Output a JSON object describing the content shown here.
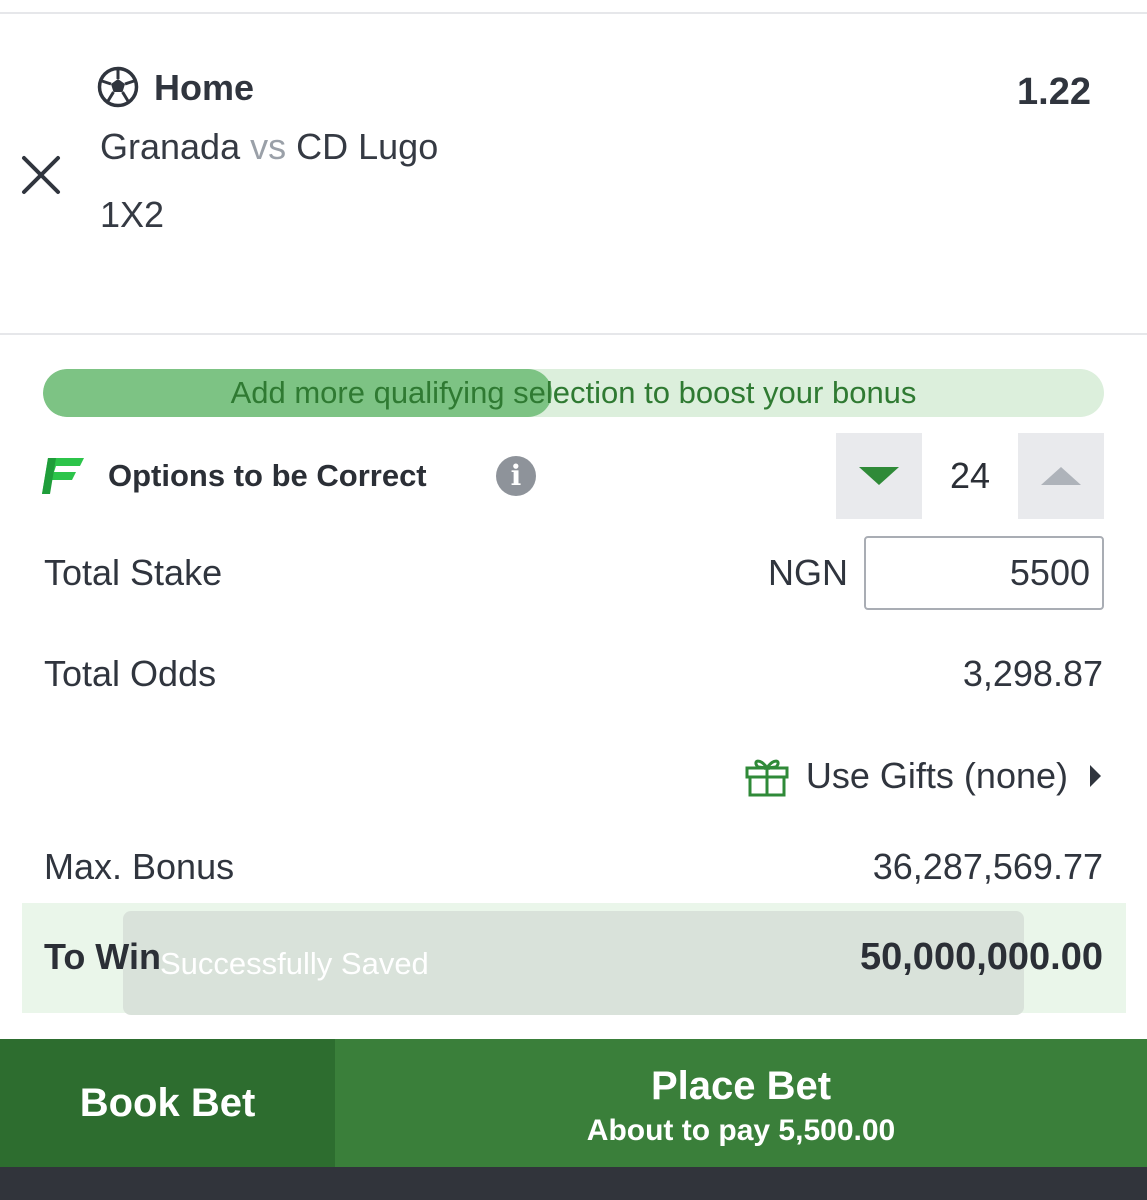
{
  "selection": {
    "pick": "Home",
    "odds": "1.22",
    "home_team": "Granada",
    "vs": "vs",
    "away_team": "CD Lugo",
    "market": "1X2"
  },
  "bonus": {
    "message": "Add more qualifying selection to boost your bonus",
    "progress_percent": 48
  },
  "options": {
    "label": "Options to be Correct",
    "info_glyph": "i",
    "value": "24"
  },
  "stake": {
    "label": "Total Stake",
    "currency": "NGN",
    "value": "5500"
  },
  "total_odds": {
    "label": "Total Odds",
    "value": "3,298.87"
  },
  "gifts": {
    "label": "Use Gifts (none)"
  },
  "max_bonus": {
    "label": "Max. Bonus",
    "value": "36,287,569.77"
  },
  "to_win": {
    "label": "To Win",
    "value": "50,000,000.00"
  },
  "toast": {
    "message": "Successfully Saved"
  },
  "buttons": {
    "book_bet": "Book Bet",
    "place_bet": "Place Bet",
    "place_bet_sub": "About to pay 5,500.00"
  },
  "icons": {
    "remove": "close-icon",
    "sport": "soccer-ball-icon",
    "flex": "flex-logo-icon",
    "info": "info-icon",
    "decrease": "chevron-down-icon",
    "increase": "chevron-up-icon",
    "gift": "gift-icon",
    "gifts_arrow": "caret-right-icon"
  },
  "colors": {
    "brand_green": "#3a7f3a",
    "book_green": "#2d6d2f",
    "accent_green": "#2f8a38",
    "bonus_fill": "#7dc384",
    "bonus_track": "#dcefdc",
    "text_dark": "#30353e"
  }
}
